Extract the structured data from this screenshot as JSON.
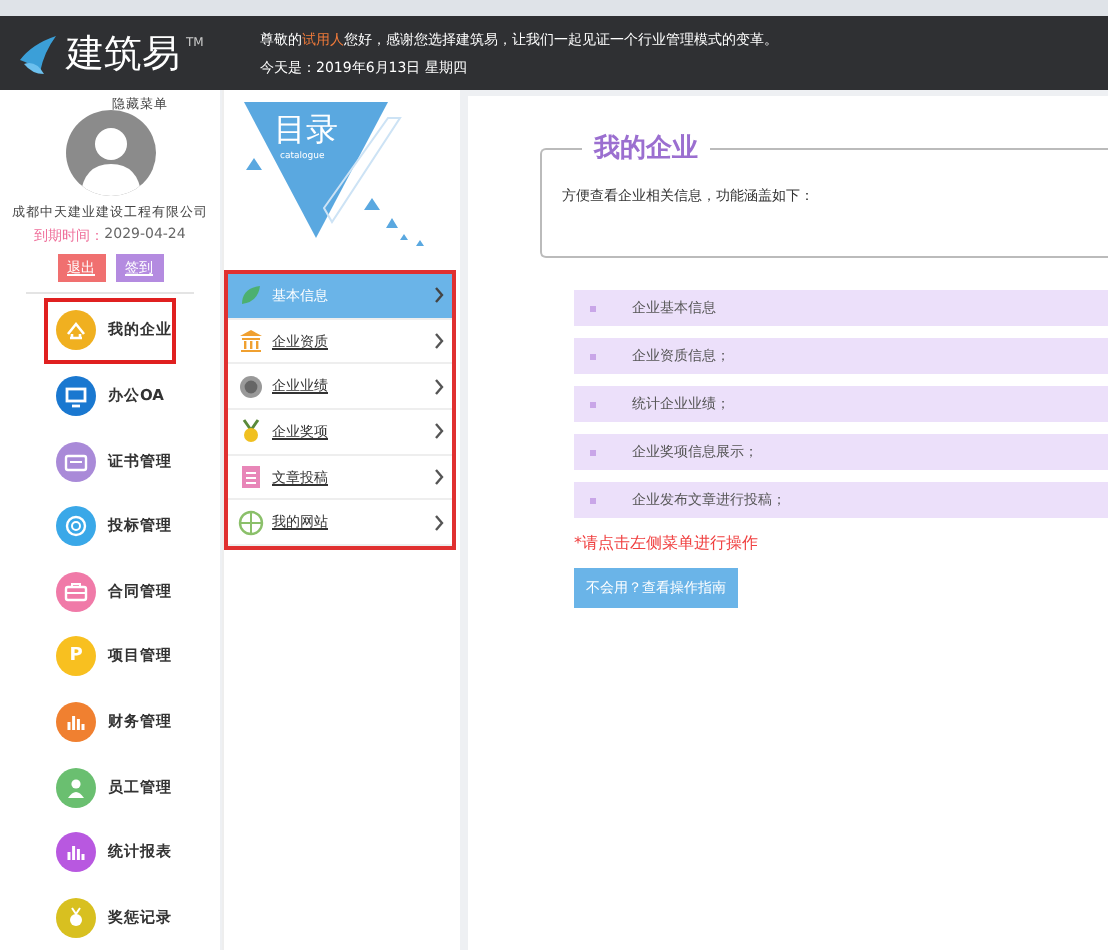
{
  "header": {
    "logo": "建筑易",
    "trademark": "TM",
    "greeting": {
      "before": "尊敬的",
      "user": "试用人",
      "after": "您好，感谢您选择建筑易，让我们一起见证一个行业管理模式的变革。"
    },
    "date": "今天是：2019年6月13日 星期四"
  },
  "profile": {
    "hide_menu": "隐藏菜单",
    "company": "成都中天建业建设工程有限公司",
    "expiry_label": "到期时间：",
    "expiry_date": "2029-04-24",
    "buttons": [
      {
        "label": "退出",
        "kind": "logout"
      },
      {
        "label": "签到",
        "kind": "checkin"
      }
    ]
  },
  "nav": [
    {
      "label": "我的企业",
      "color": "#f0b020",
      "selected": true
    },
    {
      "label": "办公OA",
      "color": "#1a78d0",
      "selected": false
    },
    {
      "label": "证书管理",
      "color": "#a98ad8",
      "selected": false
    },
    {
      "label": "投标管理",
      "color": "#3aa8e8",
      "selected": false
    },
    {
      "label": "合同管理",
      "color": "#f07aa8",
      "selected": false
    },
    {
      "label": "项目管理",
      "icon_text": "P",
      "color": "#f8c020",
      "selected": false
    },
    {
      "label": "财务管理",
      "color": "#f08030",
      "selected": false
    },
    {
      "label": "员工管理",
      "color": "#6abf70",
      "selected": false
    },
    {
      "label": "统计报表",
      "color": "#b858e0",
      "selected": false
    },
    {
      "label": "奖惩记录",
      "color": "#d8c020",
      "selected": false
    }
  ],
  "submenu": {
    "title": "目录",
    "subtitle": "catalogue",
    "items": [
      {
        "label": "基本信息",
        "selected": true
      },
      {
        "label": "企业资质",
        "selected": false
      },
      {
        "label": "企业业绩",
        "selected": false
      },
      {
        "label": "企业奖项",
        "selected": false
      },
      {
        "label": "文章投稿",
        "selected": false
      },
      {
        "label": "我的网站",
        "selected": false
      }
    ]
  },
  "main": {
    "title": "我的企业",
    "description": "方便查看企业相关信息，功能涵盖如下：",
    "features": [
      "企业基本信息",
      "企业资质信息；",
      "统计企业业绩；",
      "企业奖项信息展示；",
      "企业发布文章进行投稿；"
    ],
    "note": "*请点击左侧菜单进行操作",
    "help_button": "不会用？查看操作指南"
  }
}
